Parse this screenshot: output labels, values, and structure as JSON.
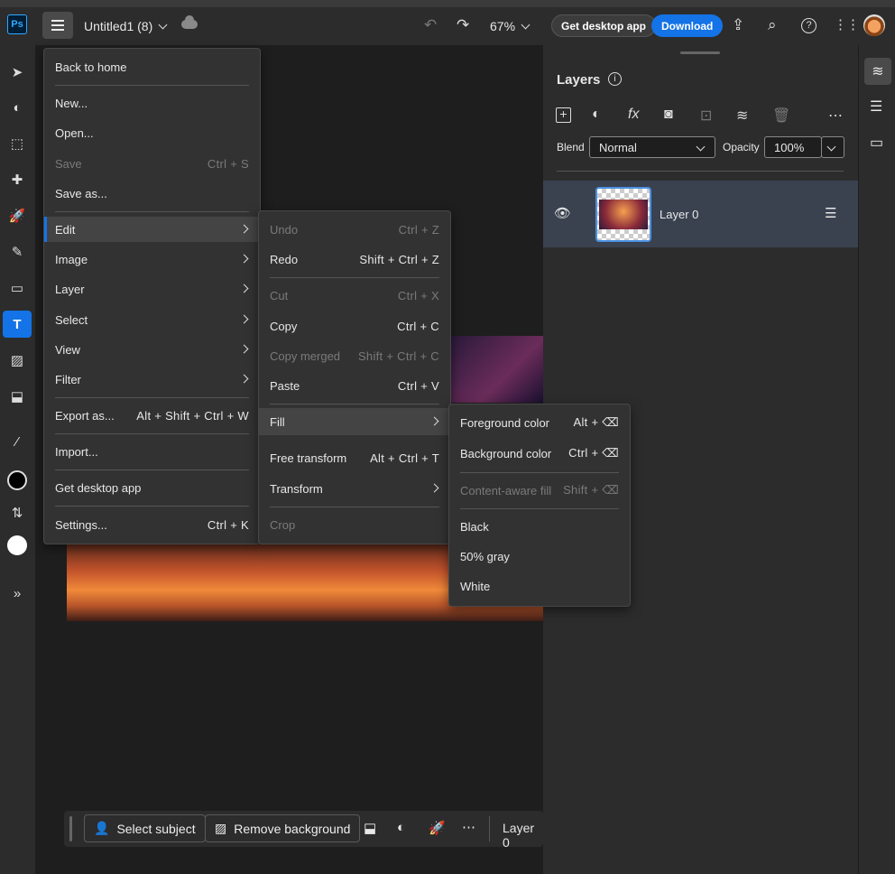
{
  "topbar": {
    "logo": "Ps",
    "doc_title": "Untitled1 (8)",
    "zoom": "67%",
    "get_desktop_label": "Get desktop app",
    "download_label": "Download"
  },
  "file_menu": {
    "items": [
      {
        "label": "Back to home"
      },
      {
        "label": "New..."
      },
      {
        "label": "Open..."
      },
      {
        "label": "Save",
        "shortcut": "Ctrl + S"
      },
      {
        "label": "Save as..."
      },
      {
        "label": "Edit"
      },
      {
        "label": "Image"
      },
      {
        "label": "Layer"
      },
      {
        "label": "Select"
      },
      {
        "label": "View"
      },
      {
        "label": "Filter"
      },
      {
        "label": "Export as...",
        "shortcut": "Alt + Shift + Ctrl + W"
      },
      {
        "label": "Import..."
      },
      {
        "label": "Get desktop app"
      },
      {
        "label": "Settings...",
        "shortcut": "Ctrl + K"
      }
    ]
  },
  "edit_menu": {
    "items": [
      {
        "label": "Undo",
        "shortcut": "Ctrl + Z"
      },
      {
        "label": "Redo",
        "shortcut": "Shift + Ctrl + Z"
      },
      {
        "label": "Cut",
        "shortcut": "Ctrl + X"
      },
      {
        "label": "Copy",
        "shortcut": "Ctrl + C"
      },
      {
        "label": "Copy merged",
        "shortcut": "Shift + Ctrl + C"
      },
      {
        "label": "Paste",
        "shortcut": "Ctrl + V"
      },
      {
        "label": "Fill"
      },
      {
        "label": "Free transform",
        "shortcut": "Alt + Ctrl + T"
      },
      {
        "label": "Transform"
      },
      {
        "label": "Crop"
      }
    ]
  },
  "fill_menu": {
    "items": [
      {
        "label": "Foreground color",
        "shortcut": "Alt + ⌫"
      },
      {
        "label": "Background color",
        "shortcut": "Ctrl + ⌫"
      },
      {
        "label": "Content-aware fill",
        "shortcut": "Shift + ⌫"
      },
      {
        "label": "Black"
      },
      {
        "label": "50% gray"
      },
      {
        "label": "White"
      }
    ]
  },
  "layers_panel": {
    "title": "Layers",
    "blend_label": "Blend",
    "blend_value": "Normal",
    "opacity_label": "Opacity",
    "opacity_value": "100%",
    "layer_name": "Layer 0"
  },
  "bottom_bar": {
    "select_subject": "Select subject",
    "remove_background": "Remove background",
    "layer_label": "Layer 0"
  },
  "colors": {
    "accent": "#1473e6",
    "panel": "#2c2c2c",
    "canvas": "#1e1e1e"
  }
}
